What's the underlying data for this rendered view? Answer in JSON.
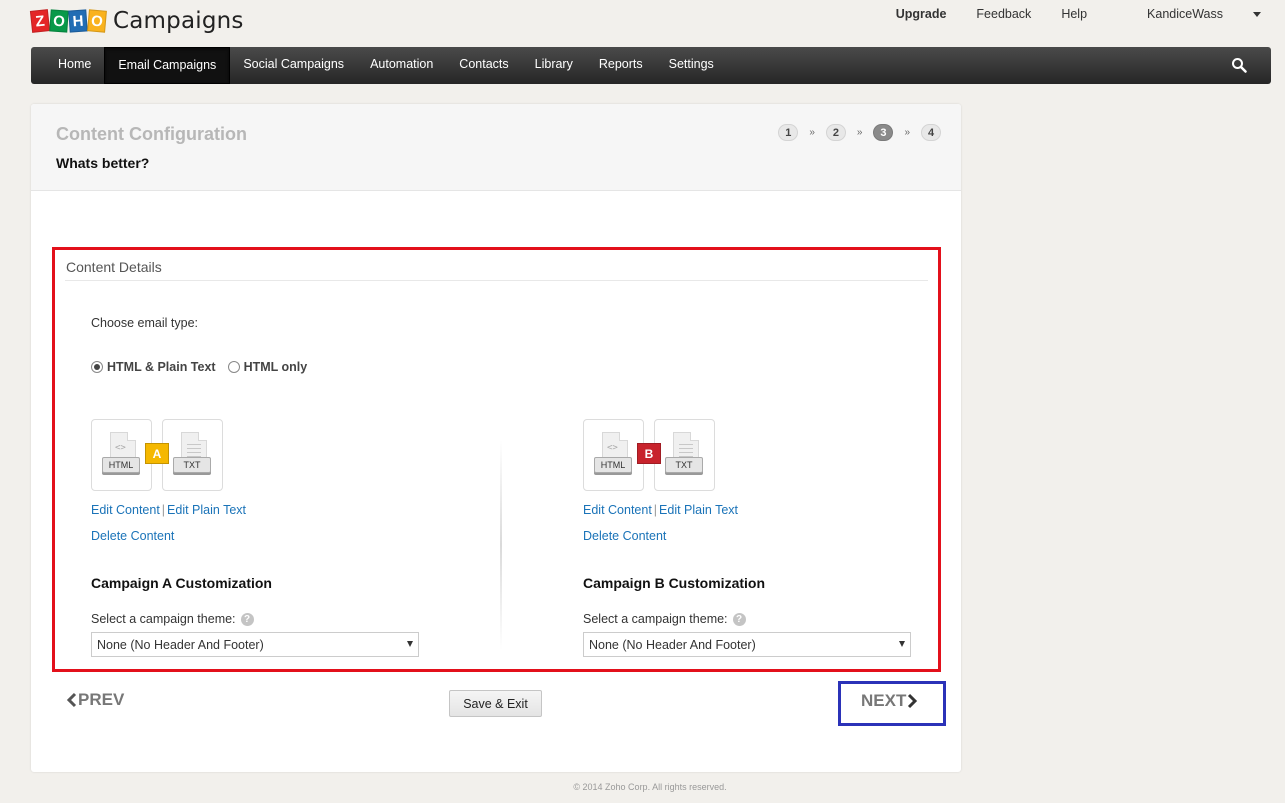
{
  "app": {
    "logo_letters": [
      "Z",
      "O",
      "H",
      "O"
    ],
    "name": "Campaigns"
  },
  "top_links": {
    "upgrade": "Upgrade",
    "feedback": "Feedback",
    "help": "Help",
    "user": "KandiceWass"
  },
  "nav": {
    "items": [
      {
        "label": "Home",
        "active": false
      },
      {
        "label": "Email Campaigns",
        "active": true
      },
      {
        "label": "Social Campaigns",
        "active": false
      },
      {
        "label": "Automation",
        "active": false
      },
      {
        "label": "Contacts",
        "active": false
      },
      {
        "label": "Library",
        "active": false
      },
      {
        "label": "Reports",
        "active": false
      },
      {
        "label": "Settings",
        "active": false
      }
    ],
    "search_icon": "search-icon"
  },
  "page": {
    "title": "Content Configuration",
    "subtitle": "Whats better?",
    "steps": [
      "1",
      "2",
      "3",
      "4"
    ],
    "step_separator": "»",
    "current_step": "3"
  },
  "content_details": {
    "title": "Content Details",
    "choose_label": "Choose email type:",
    "radio_options": [
      {
        "label": "HTML & Plain Text",
        "checked": true
      },
      {
        "label": "HTML only",
        "checked": false
      }
    ],
    "variant_a": {
      "badge": "A",
      "html_tag": "HTML",
      "txt_tag": "TXT",
      "edit_content": "Edit Content",
      "link_separator": "|",
      "edit_plain_text": "Edit Plain Text",
      "delete_content": "Delete Content",
      "customization_title": "Campaign A Customization",
      "theme_label": "Select a campaign theme:",
      "help_glyph": "?",
      "theme_value": "None (No Header And Footer)"
    },
    "variant_b": {
      "badge": "B",
      "html_tag": "HTML",
      "txt_tag": "TXT",
      "edit_content": "Edit Content",
      "link_separator": "|",
      "edit_plain_text": "Edit Plain Text",
      "delete_content": "Delete Content",
      "customization_title": "Campaign B Customization",
      "theme_label": "Select a campaign theme:",
      "help_glyph": "?",
      "theme_value": "None (No Header And Footer)"
    }
  },
  "actions": {
    "prev": "PREV",
    "save_exit": "Save & Exit",
    "next": "NEXT"
  },
  "footer": {
    "copyright": "© 2014 Zoho Corp. All rights reserved."
  },
  "colors": {
    "highlight_red": "#e3101b",
    "highlight_blue": "#2b32b8",
    "link_blue": "#1a73b8",
    "badge_a": "#f5b800",
    "badge_b": "#c8232c"
  }
}
